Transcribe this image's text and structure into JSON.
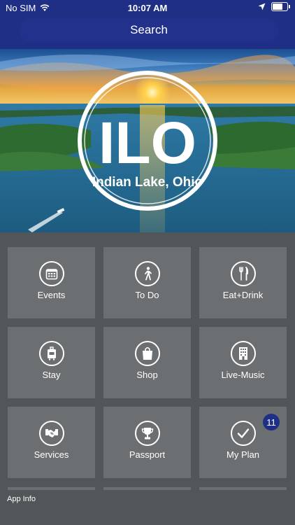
{
  "status_bar": {
    "carrier": "No SIM",
    "time": "10:07 AM",
    "battery_level": 0.8
  },
  "header": {
    "search_label": "Search"
  },
  "hero": {
    "logo_text": "ILO",
    "logo_subtitle": "Indian Lake, Ohio"
  },
  "tiles": [
    {
      "label": "Events",
      "icon": "calendar-icon"
    },
    {
      "label": "To Do",
      "icon": "walking-person-icon"
    },
    {
      "label": "Eat+Drink",
      "icon": "fork-knife-icon"
    },
    {
      "label": "Stay",
      "icon": "luggage-icon"
    },
    {
      "label": "Shop",
      "icon": "shopping-bag-icon"
    },
    {
      "label": "Live-Music",
      "icon": "building-icon"
    },
    {
      "label": "Services",
      "icon": "handshake-icon"
    },
    {
      "label": "Passport",
      "icon": "trophy-icon"
    },
    {
      "label": "My Plan",
      "icon": "checkmark-icon",
      "badge": "11"
    }
  ],
  "footer": {
    "app_info_label": "App Info"
  },
  "colors": {
    "nav_blue": "#1f2f86",
    "tile_gray": "#6b6f71",
    "background": "#515759"
  }
}
